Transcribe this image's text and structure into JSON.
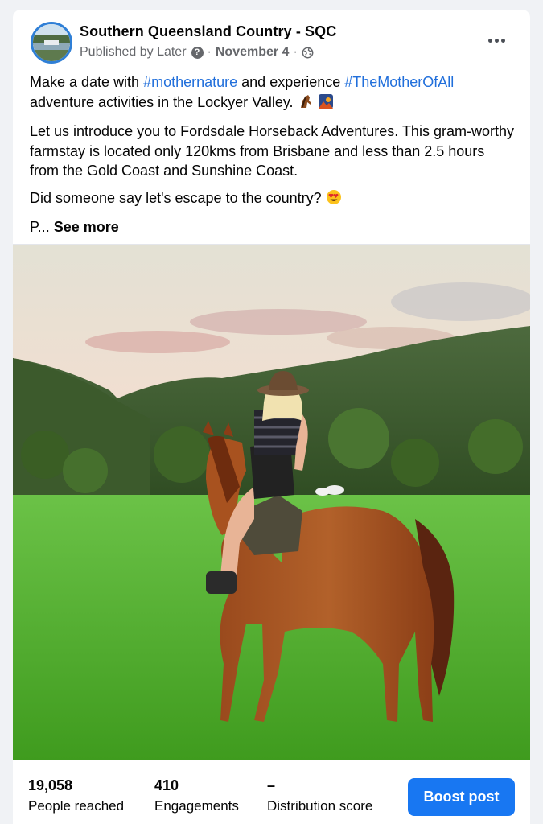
{
  "post": {
    "page_name": "Southern Queensland Country - SQC",
    "published_by": "Published by Later",
    "date": "November 4",
    "separator": "·",
    "audience_icon": "globe-icon",
    "paragraphs": {
      "p1_pre": "Make a date with ",
      "p1_tag1": "#mothernature",
      "p1_mid": " and experience ",
      "p1_tag2": "#TheMotherOfAll",
      "p1_post": " adventure activities in the Lockyer Valley.",
      "p2": "Let us introduce you to Fordsdale Horseback Adventures. This gram-worthy farmstay is located only 120kms from Brisbane and less than 2.5 hours from the Gold Coast and Sunshine Coast.",
      "p3": "Did someone say let's escape to the country?",
      "p4_trunc": "P...",
      "see_more": "See more"
    },
    "hashtag_color": "#216fdb"
  },
  "stats": [
    {
      "value": "19,058",
      "label": "People reached"
    },
    {
      "value": "410",
      "label": "Engagements"
    },
    {
      "value": "–",
      "label": "Distribution score"
    }
  ],
  "boost_button": {
    "label": "Boost post",
    "color": "#1877f2"
  }
}
